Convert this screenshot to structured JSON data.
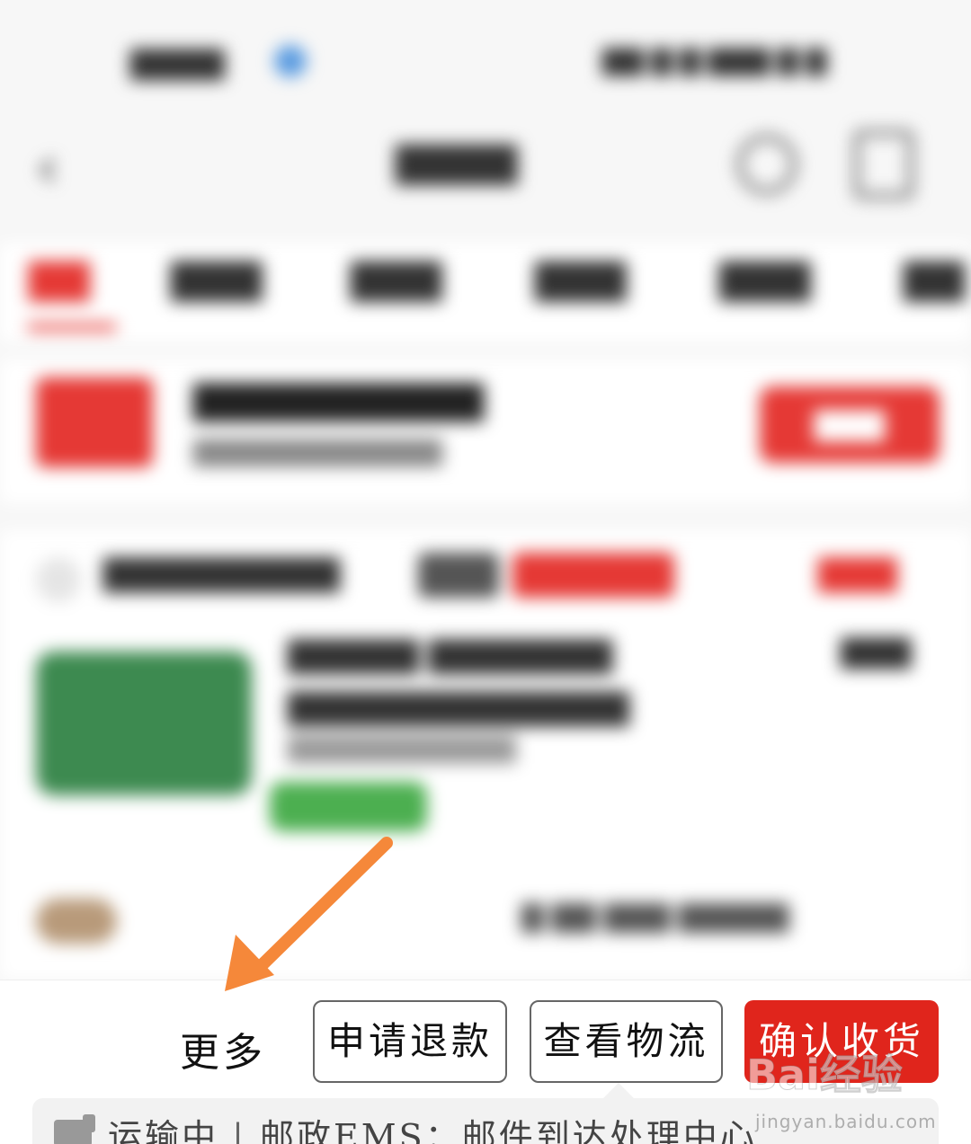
{
  "actions": {
    "more_label": "更多",
    "refund_label": "申请退款",
    "logistics_label": "查看物流",
    "confirm_label": "确认收货"
  },
  "logistics": {
    "status": "运输中",
    "divider": "|",
    "detail": "邮政EMS：邮件到达处理中心"
  },
  "watermark": {
    "logo_text": "Bai经验",
    "url": "jingyan.baidu.com"
  },
  "colors": {
    "accent_red": "#e0251c",
    "annotation_arrow": "#f5883a",
    "logistics_bg": "#f2f2f2"
  },
  "icons": {
    "back": "chevron-left-icon",
    "search": "search-icon",
    "menu": "more-icon",
    "truck": "truck-icon",
    "arrow": "arrow-icon"
  }
}
